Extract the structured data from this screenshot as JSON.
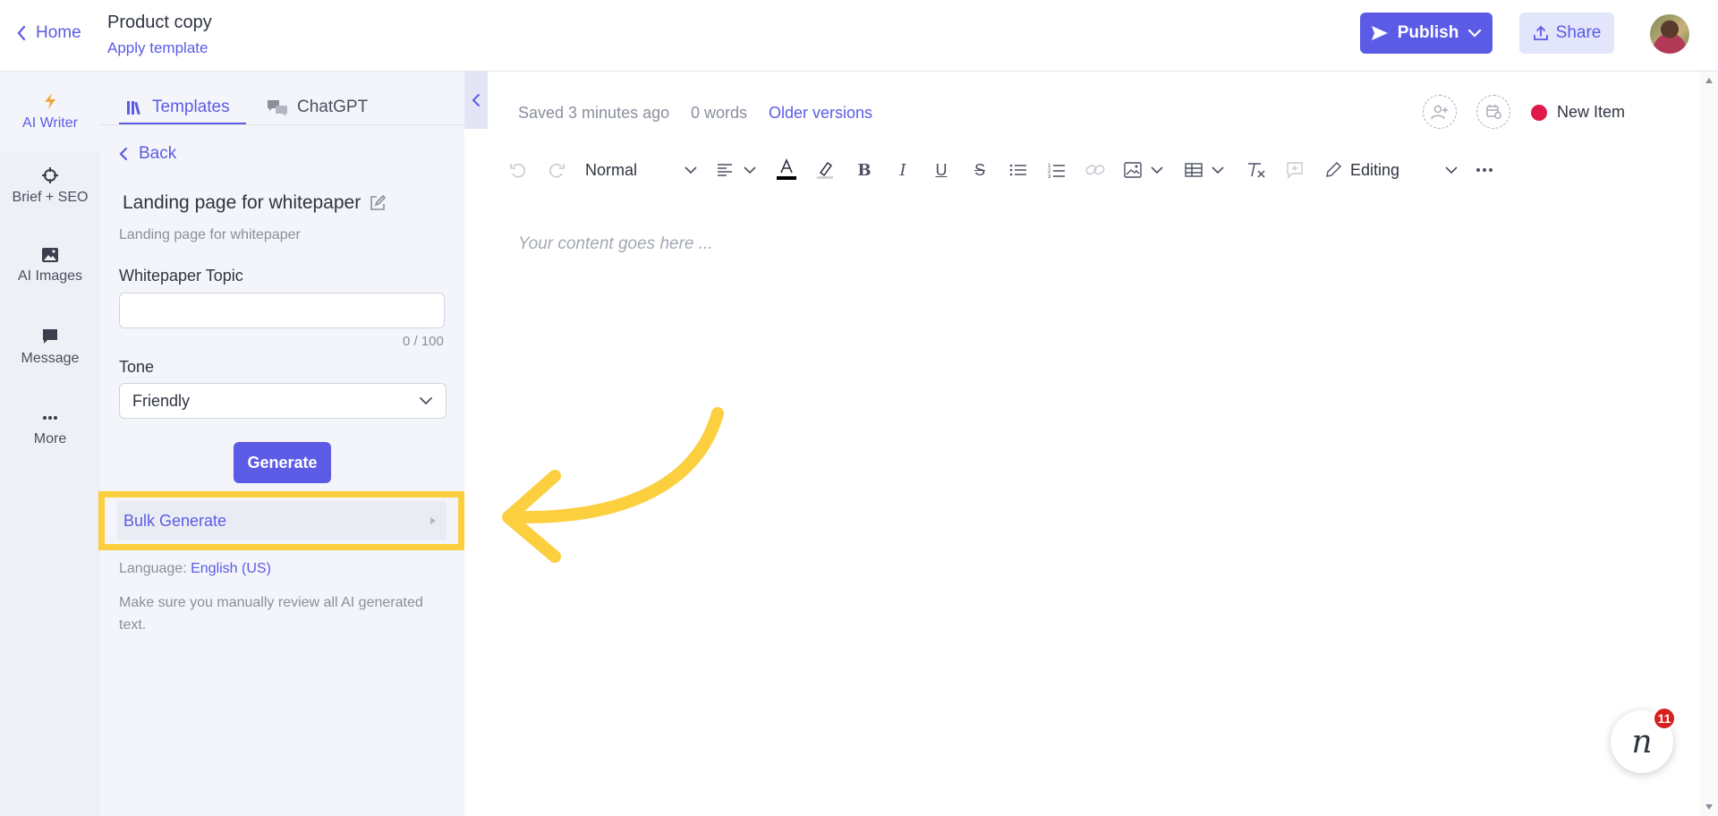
{
  "header": {
    "home_label": "Home",
    "doc_title": "Product copy",
    "doc_subtitle": "Apply template",
    "publish_label": "Publish",
    "share_label": "Share"
  },
  "rail": {
    "items": [
      {
        "label": "AI Writer",
        "icon": "bolt-icon"
      },
      {
        "label": "Brief + SEO",
        "icon": "crosshair-icon"
      },
      {
        "label": "AI Images",
        "icon": "image-icon"
      },
      {
        "label": "Message",
        "icon": "message-icon"
      },
      {
        "label": "More",
        "icon": "more-icon"
      }
    ]
  },
  "panel": {
    "tabs": [
      {
        "label": "Templates",
        "icon": "library-icon"
      },
      {
        "label": "ChatGPT",
        "icon": "chat-icon"
      }
    ],
    "back_label": "Back",
    "template_title": "Landing page for whitepaper",
    "template_description": "Landing page for whitepaper",
    "topic_label": "Whitepaper Topic",
    "topic_value": "",
    "topic_counter": "0 / 100",
    "tone_label": "Tone",
    "tone_value": "Friendly",
    "generate_label": "Generate",
    "bulk_label": "Bulk Generate",
    "language_prefix": "Language:",
    "language_value": "English (US)",
    "note": "Make sure you manually review all AI generated text."
  },
  "editor": {
    "saved_status": "Saved 3 minutes ago",
    "word_count": "0 words",
    "older_versions": "Older versions",
    "status_label": "New Item",
    "status_color": "#e0194a",
    "style_value": "Normal",
    "mode_value": "Editing",
    "placeholder": "Your content goes here ..."
  },
  "help": {
    "badge_count": "11",
    "glyph": "n"
  },
  "colors": {
    "accent": "#5b5be6",
    "highlight": "#fccf3f"
  }
}
